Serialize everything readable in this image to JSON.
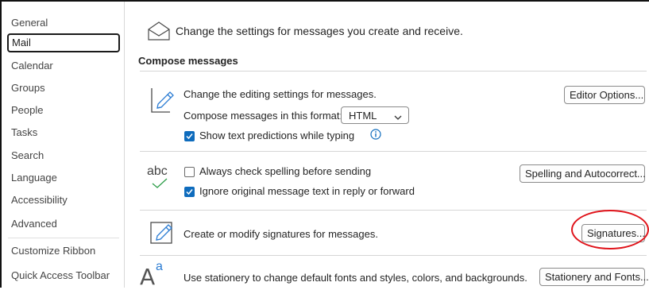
{
  "sidebar": {
    "items": [
      {
        "label": "General"
      },
      {
        "label": "Mail"
      },
      {
        "label": "Calendar"
      },
      {
        "label": "Groups"
      },
      {
        "label": "People"
      },
      {
        "label": "Tasks"
      },
      {
        "label": "Search"
      },
      {
        "label": "Language"
      },
      {
        "label": "Accessibility"
      },
      {
        "label": "Advanced"
      },
      {
        "label": "Customize Ribbon"
      },
      {
        "label": "Quick Access Toolbar"
      }
    ],
    "selected": "Mail"
  },
  "main": {
    "header": "Change the settings for messages you create and receive.",
    "section_title": "Compose messages",
    "editing": {
      "description": "Change the editing settings for messages.",
      "button": "Editor Options...",
      "format_label": "Compose messages in this format:",
      "format_value": "HTML",
      "predictions_label": "Show text predictions while typing",
      "predictions_checked": true
    },
    "spelling": {
      "icon_text": "abc",
      "always_check_label": "Always check spelling before sending",
      "always_check_checked": false,
      "ignore_original_label": "Ignore original message text in reply or forward",
      "ignore_original_checked": true,
      "button": "Spelling and Autocorrect..."
    },
    "signatures": {
      "description": "Create or modify signatures for messages.",
      "button": "Signatures..."
    },
    "stationery": {
      "icon_text": "A",
      "icon_superscript": "a",
      "description": "Use stationery to change default fonts and styles, colors, and backgrounds.",
      "button": "Stationery and Fonts..."
    }
  },
  "colors": {
    "accent": "#0f6cbd",
    "annotation": "#e0141b"
  }
}
